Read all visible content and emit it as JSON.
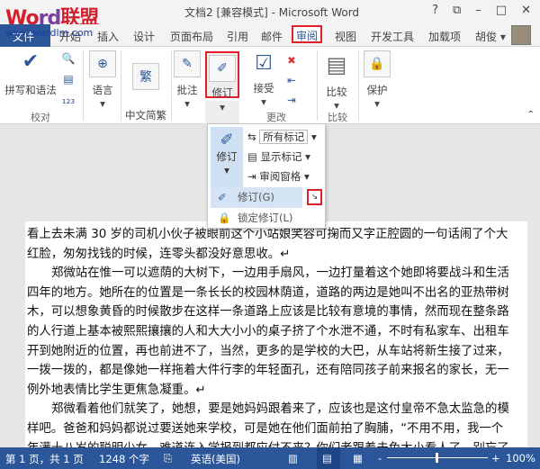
{
  "watermark": {
    "logo": "Word联盟",
    "url": "www.wordlm.com"
  },
  "window": {
    "title": "文档2 [兼容模式] - Microsoft Word",
    "help": "?",
    "restore": "⧉",
    "minimize": "–",
    "maximize": "□",
    "close": "✕"
  },
  "tabs": [
    "文件",
    "开始",
    "插入",
    "设计",
    "页面布局",
    "引用",
    "邮件",
    "审阅",
    "视图",
    "开发工具",
    "加载项",
    "胡俊 ▾"
  ],
  "active_tab": "审阅",
  "ribbon": {
    "spelling": "拼写和语法",
    "language": "语言",
    "chinese_convert": "中文简繁\n转换",
    "comment": "批注",
    "track": "修订",
    "accept": "接受",
    "compare": "比较",
    "protect": "保护",
    "groups": {
      "proofing": "校对",
      "changes": "更改",
      "compare": "比较"
    }
  },
  "popup": {
    "track": "修订",
    "all_markup": "所有标记",
    "show_markup": "显示标记",
    "review_pane": "审阅窗格",
    "track_changes": "修订(G)",
    "lock_tracking": "锁定修订(L)"
  },
  "document": {
    "lines": [
      "看上去未满 30 岁的司机小伙子被眼前这个小站娘笑容可掬而又字正腔圆的一句话闹了个大",
      "红脸，匆匆找钱的时候，连零头都没好意思收。↵",
      "郑微站在惟一可以遮荫的大树下，一边用手扇风，一边打量着这个她即将要战斗和生活",
      "四年的地方。她所在的位置是一条长长的校园林荫道，道路的两边是她叫不出名的亚热带树",
      "木，可以想象黄昏的时候散步在这样一条道路上应该是比较有意境的事情，然而现在整条路",
      "的人行道上基本被熙熙攘攘的人和大大小小的桌子挤了个水泄不通，不时有私家车、出租车",
      "开到她附近的位置，再也前进不了，当然，更多的是学校的大巴，从车站将新生接了过来，",
      "一拨一拨的，都是像她一样拖着大件行李的年轻面孔，还有陪同孩子前来报名的家长，无一",
      "例外地表情比学生更焦急凝重。↵",
      "郑微看着他们就笑了，她想，要是她妈妈跟着来了，应该也是这付皇帝不急太监急的模",
      "样吧。爸爸和妈妈都说过要送她来学校，可是她在他们面前拍了胸脯，“不用不用，我一个",
      "年满十八岁的聪明少女，难道连入学报到都应付不来？你们老跟着未免太小看人了，别忘了"
    ]
  },
  "status": {
    "page": "第 1 页，共 1 页",
    "words": "1248 个字",
    "language": "英语(美国)",
    "zoom": "100%",
    "zoom_level_percent": 100
  },
  "colors": {
    "accent": "#2b579a",
    "highlight": "#e0202a"
  }
}
